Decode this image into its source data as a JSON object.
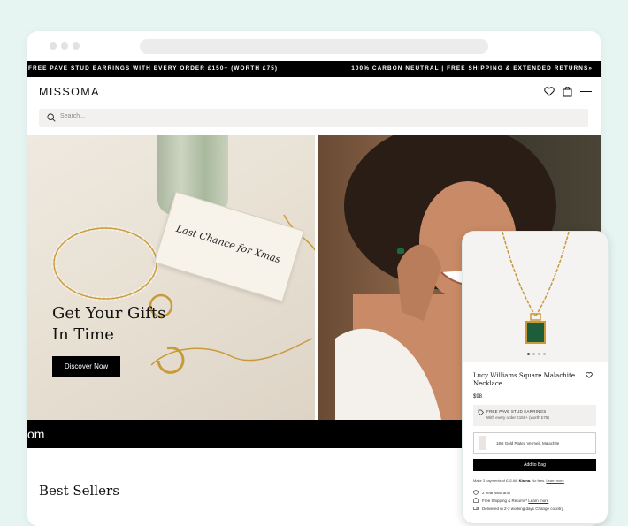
{
  "promo": {
    "left": "FREE PAVE STUD EARRINGS WITH EVERY ORDER £150+ (WORTH £75)",
    "right": "100% CARBON NEUTRAL | FREE SHIPPING & EXTENDED RETURNS»"
  },
  "header": {
    "logo": "MISSOMA"
  },
  "search": {
    "placeholder": "Search..."
  },
  "hero": {
    "title": "Get Your Gifts\nIn Time",
    "cta": "Discover Now",
    "placecard": "Last Chance for Xmas"
  },
  "bottombar": {
    "text": "om"
  },
  "section": {
    "title": "Best Sellers"
  },
  "product": {
    "title": "Lucy Williams Square Malachite Necklace",
    "price": "$98",
    "free_title": "FREE PAVE STUD EARRINGS",
    "free_sub": "With every order £150+ (worth £75)",
    "variant": "18ct Gold Plated Vermeil, Malachite",
    "add_to_bag": "Add to Bag",
    "klarna_text": "Make 3 payments of £32.66.",
    "klarna_brand": "Klarna.",
    "klarna_suffix": "No fees.",
    "klarna_link": "Learn more",
    "benefits": [
      "2 Year Warranty",
      "Free Shipping & Returns*",
      "Delivered in 2-3 working days Change country"
    ],
    "benefit_link": "Learn more"
  },
  "colors": {
    "accent": "#000000",
    "background": "#e6f4f2"
  }
}
